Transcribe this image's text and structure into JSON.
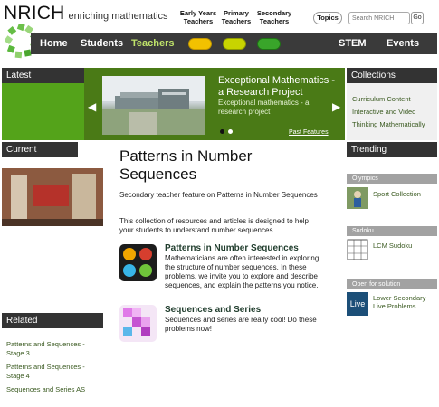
{
  "brand": {
    "name": "NRICH",
    "tagline": "enriching mathematics"
  },
  "audiences": [
    {
      "label": "Early Years Teachers",
      "color": "#f2c100"
    },
    {
      "label": "Primary Teachers",
      "color": "#c8d400"
    },
    {
      "label": "Secondary Teachers",
      "color": "#39a52a"
    }
  ],
  "topics_label": "Topics",
  "search": {
    "placeholder": "Search NRICH",
    "go_label": "Go"
  },
  "nav": {
    "items": [
      {
        "label": "Home"
      },
      {
        "label": "Students"
      },
      {
        "label": "Teachers"
      },
      {
        "label": "STEM"
      },
      {
        "label": "Events"
      }
    ],
    "active": "Teachers",
    "active_color": "#bfe36a"
  },
  "latest": {
    "heading": "Latest",
    "feature_title": "Exceptional Mathematics - a Research Project",
    "feature_subtitle": "Exceptional mathematics - a research project",
    "past_label": "Past Features"
  },
  "collections": {
    "heading": "Collections",
    "items": [
      "Curriculum Content",
      "Interactive and Video",
      "Thinking Mathematically"
    ]
  },
  "current": {
    "heading": "Current"
  },
  "related": {
    "heading": "Related",
    "links": [
      "Patterns and Sequences - Stage 3",
      "Patterns and Sequences - Stage 4",
      "Sequences and Series AS"
    ]
  },
  "main": {
    "title": "Patterns in Number Sequences",
    "intro": "Secondary teacher feature on Patterns in Number Sequences",
    "intro2": "This collection of resources and articles is designed to help your students to understand number sequences.",
    "items": [
      {
        "title": "Patterns in Number Sequences",
        "desc": "Mathematicians are often interested in exploring the structure of number sequences. In these problems, we invite you to explore and describe sequences, and explain the patterns you notice."
      },
      {
        "title": "Sequences and Series",
        "desc": "Sequences and series are really cool! Do these problems now!"
      }
    ]
  },
  "trending": {
    "heading": "Trending",
    "entries": [
      {
        "category": "Olympics",
        "link": "Sport Collection"
      },
      {
        "category": "Sudoku",
        "link": "LCM Sudoku"
      },
      {
        "category": "Open for solution",
        "link": "Lower Secondary Live Problems",
        "thumb_text": "Live"
      }
    ]
  }
}
